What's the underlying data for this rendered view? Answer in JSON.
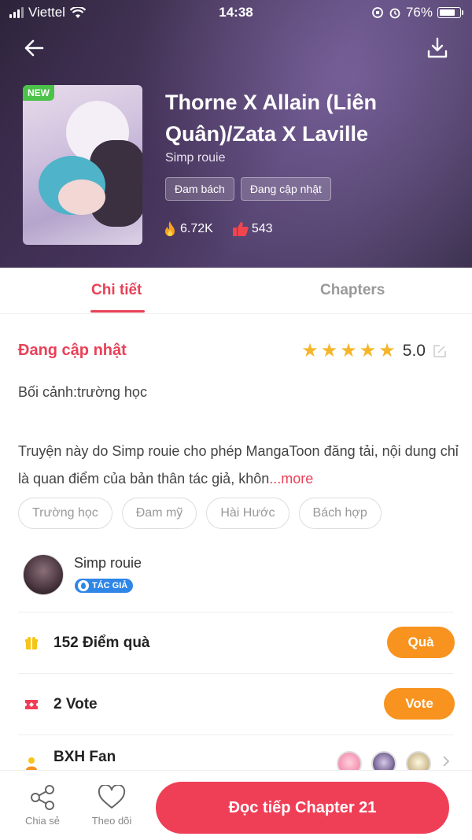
{
  "status_bar": {
    "carrier": "Viettel",
    "time": "14:38",
    "battery": "76%"
  },
  "book": {
    "badge": "NEW",
    "title": "Thorne X Allain (Liên Quân)/Zata X Laville",
    "author": "Simp rouie",
    "tags": [
      "Đam bách",
      "Đang cập nhật"
    ],
    "views": "6.72K",
    "likes": "543"
  },
  "tabs": {
    "detail": "Chi tiết",
    "chapters": "Chapters"
  },
  "detail": {
    "status": "Đang cập nhật",
    "rating": "5.0",
    "rating_stars": 5,
    "setting": "Bối cảnh:trường học",
    "description": "Truyện này do Simp rouie cho phép MangaToon đăng tải, nội dung chỉ là quan điểm của bản thân tác giả, khôn",
    "more": "...more",
    "genres": [
      "Trường học",
      "Đam mỹ",
      "Hài Hước",
      "Bách hợp"
    ]
  },
  "author_card": {
    "name": "Simp rouie",
    "badge": "TÁC GIẢ"
  },
  "gifts": {
    "label": "152 Điểm quà",
    "button": "Quà"
  },
  "votes": {
    "label": "2 Vote",
    "button": "Vote"
  },
  "fans": {
    "label": "BXH Fan"
  },
  "bottom": {
    "share": "Chia sẻ",
    "follow": "Theo dõi",
    "read": "Đọc tiếp Chapter 21"
  },
  "colors": {
    "accent": "#e94057",
    "orange": "#f7931e",
    "read_button": "#ef3f57",
    "star": "#f5b62a"
  }
}
